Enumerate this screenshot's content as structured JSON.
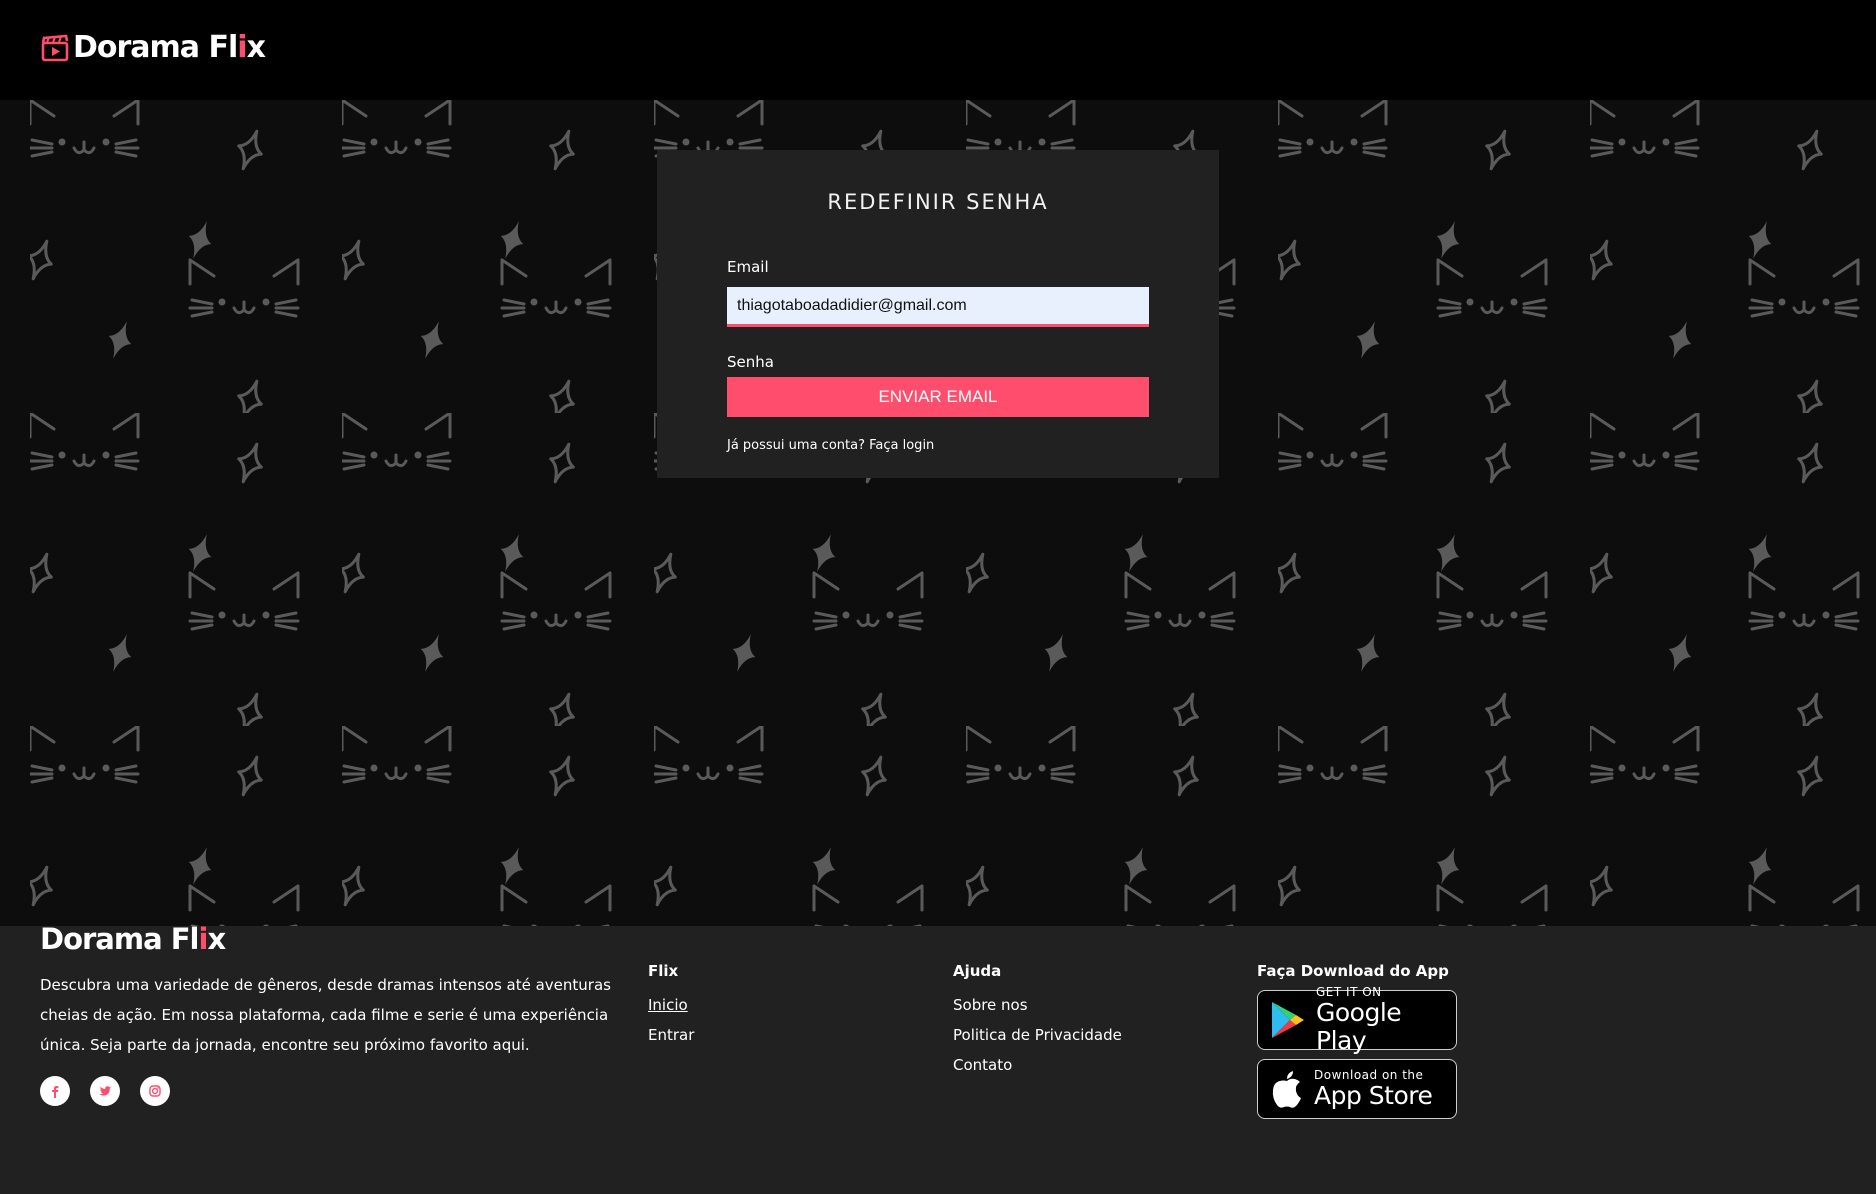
{
  "brand": {
    "name_start": "Dorama Fl",
    "name_accent": "i",
    "name_end": "x",
    "accent_color": "#ff4d6d"
  },
  "form": {
    "title": "REDEFINIR SENHA",
    "email_label": "Email",
    "email_value": "thiagotaboadadidier@gmail.com",
    "password_label": "Senha",
    "submit_label": "ENVIAR EMAIL",
    "login_prompt": "Já possui uma conta?",
    "login_link": "Faça login"
  },
  "footer": {
    "description": "Descubra uma variedade de gêneros, desde dramas intensos até aventuras cheias de ação. Em nossa plataforma, cada filme e serie é uma experiência única. Seja parte da jornada, encontre seu próximo favorito aqui.",
    "socials": [
      "facebook-icon",
      "twitter-icon",
      "instagram-icon"
    ],
    "columns": {
      "flix": {
        "title": "Flix",
        "links": [
          "Inicio",
          "Entrar"
        ]
      },
      "ajuda": {
        "title": "Ajuda",
        "links": [
          "Sobre nos",
          "Politica de Privacidade",
          "Contato"
        ]
      },
      "app": {
        "title": "Faça Download do App",
        "google_play": {
          "small": "GET IT ON",
          "big": "Google Play"
        },
        "app_store": {
          "small": "Download on the",
          "big": "App Store"
        }
      }
    }
  },
  "colors": {
    "header_bg": "#000000",
    "card_bg": "#212121",
    "footer_bg": "#212121",
    "accent": "#ff4d6d"
  }
}
